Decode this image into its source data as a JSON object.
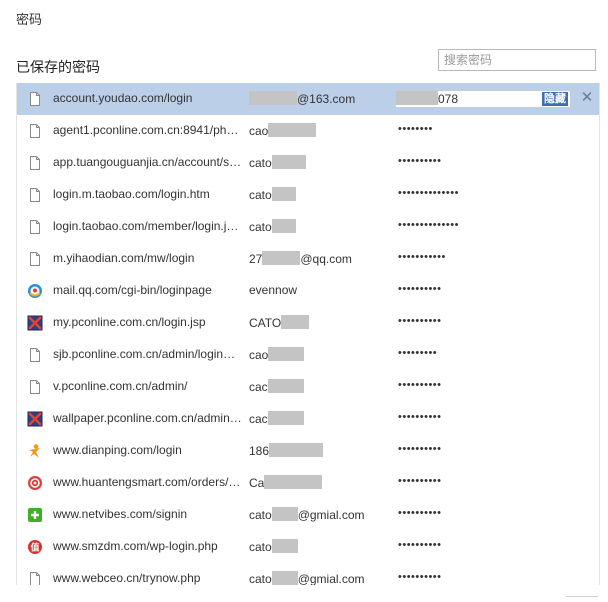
{
  "page_title": "密码",
  "section_title": "已保存的密码",
  "search": {
    "placeholder": "搜索密码",
    "value": ""
  },
  "hide_label": "隐藏",
  "rows": [
    {
      "url": "account.youdao.com/login",
      "user_pre": "",
      "user_suf": "@163.com",
      "pwd_suf": "078",
      "icon": "page-icon",
      "redact_w": 48
    },
    {
      "url": "agent1.pconline.com.cn:8941/phot…",
      "user_pre": "cao",
      "user_suf": "",
      "pwd": "••••••••",
      "icon": "page-icon",
      "redact_w": 48
    },
    {
      "url": "app.tuangouguanjia.cn/account/si…",
      "user_pre": "cato",
      "user_suf": "",
      "pwd": "••••••••••",
      "icon": "page-icon",
      "redact_w": 34
    },
    {
      "url": "login.m.taobao.com/login.htm",
      "user_pre": "cato",
      "user_suf": "",
      "pwd": "••••••••••••••",
      "icon": "page-icon",
      "redact_w": 24
    },
    {
      "url": "login.taobao.com/member/login.j…",
      "user_pre": "cato",
      "user_suf": "",
      "pwd": "••••••••••••••",
      "icon": "page-icon",
      "redact_w": 24
    },
    {
      "url": "m.yihaodian.com/mw/login",
      "user_pre": "27",
      "user_suf": "@qq.com",
      "pwd": "•••••••••••",
      "icon": "page-icon",
      "redact_w": 38
    },
    {
      "url": "mail.qq.com/cgi-bin/loginpage",
      "user_pre": "evennow",
      "user_suf": "",
      "pwd": "••••••••••",
      "icon": "qq-mail-icon",
      "redact_w": 0
    },
    {
      "url": "my.pconline.com.cn/login.jsp",
      "user_pre": "CATO",
      "user_suf": "",
      "pwd": "••••••••••",
      "icon": "pconline-icon",
      "redact_w": 28
    },
    {
      "url": "sjb.pconline.com.cn/admin/login…",
      "user_pre": "cao",
      "user_suf": "",
      "pwd": "•••••••••",
      "icon": "page-icon",
      "redact_w": 36
    },
    {
      "url": "v.pconline.com.cn/admin/",
      "user_pre": "cac",
      "user_suf": "",
      "pwd": "••••••••••",
      "icon": "page-icon",
      "redact_w": 36
    },
    {
      "url": "wallpaper.pconline.com.cn/admin…",
      "user_pre": "cac",
      "user_suf": "",
      "pwd": "••••••••••",
      "icon": "pconline-icon",
      "redact_w": 36
    },
    {
      "url": "www.dianping.com/login",
      "user_pre": "186",
      "user_suf": "",
      "pwd": "••••••••••",
      "icon": "dianping-icon",
      "redact_w": 54
    },
    {
      "url": "www.huantengsmart.com/orders/…",
      "user_pre": "Ca",
      "user_suf": "",
      "pwd": "••••••••••",
      "icon": "huanteng-icon",
      "redact_w": 58
    },
    {
      "url": "www.netvibes.com/signin",
      "user_pre": "cato",
      "user_suf": "@gmial.com",
      "pwd": "••••••••••",
      "icon": "netvibes-icon",
      "redact_w": 26
    },
    {
      "url": "www.smzdm.com/wp-login.php",
      "user_pre": "cato",
      "user_suf": "",
      "pwd": "••••••••••",
      "icon": "smzdm-icon",
      "redact_w": 26
    },
    {
      "url": "www.webceo.cn/trynow.php",
      "user_pre": "cato",
      "user_suf": "@gmial.com",
      "pwd": "••••••••••",
      "icon": "page-icon",
      "redact_w": 26
    }
  ]
}
